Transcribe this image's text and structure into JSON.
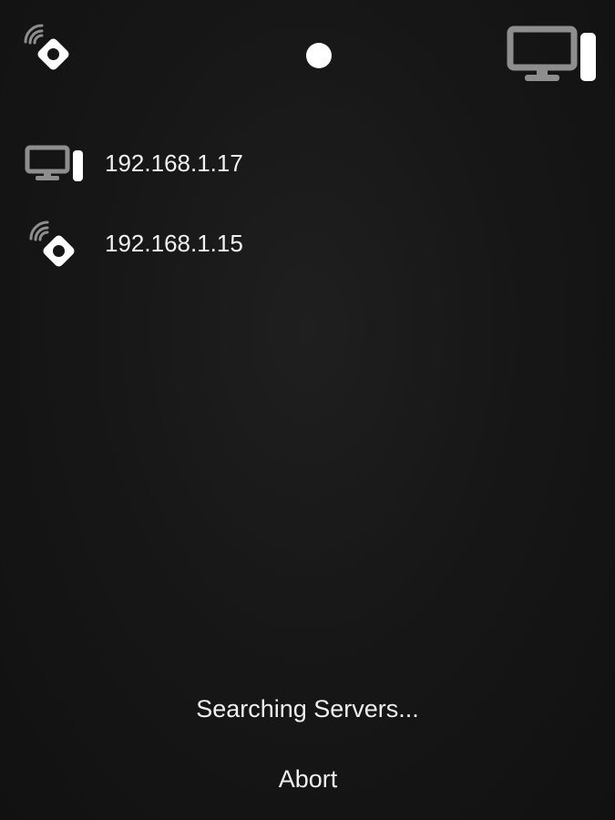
{
  "header": {
    "left_icon": "remote-control-icon",
    "center_indicator": "status-dot",
    "right_icon": "computer-icon"
  },
  "servers": [
    {
      "address": "192.168.1.17",
      "icon": "computer-icon"
    },
    {
      "address": "192.168.1.15",
      "icon": "remote-control-icon"
    }
  ],
  "footer": {
    "status": "Searching Servers...",
    "abort_label": "Abort"
  },
  "colors": {
    "background": "#161616",
    "text": "#f2f2f2",
    "icon_white": "#ffffff",
    "icon_gray": "#8e8e8e"
  }
}
